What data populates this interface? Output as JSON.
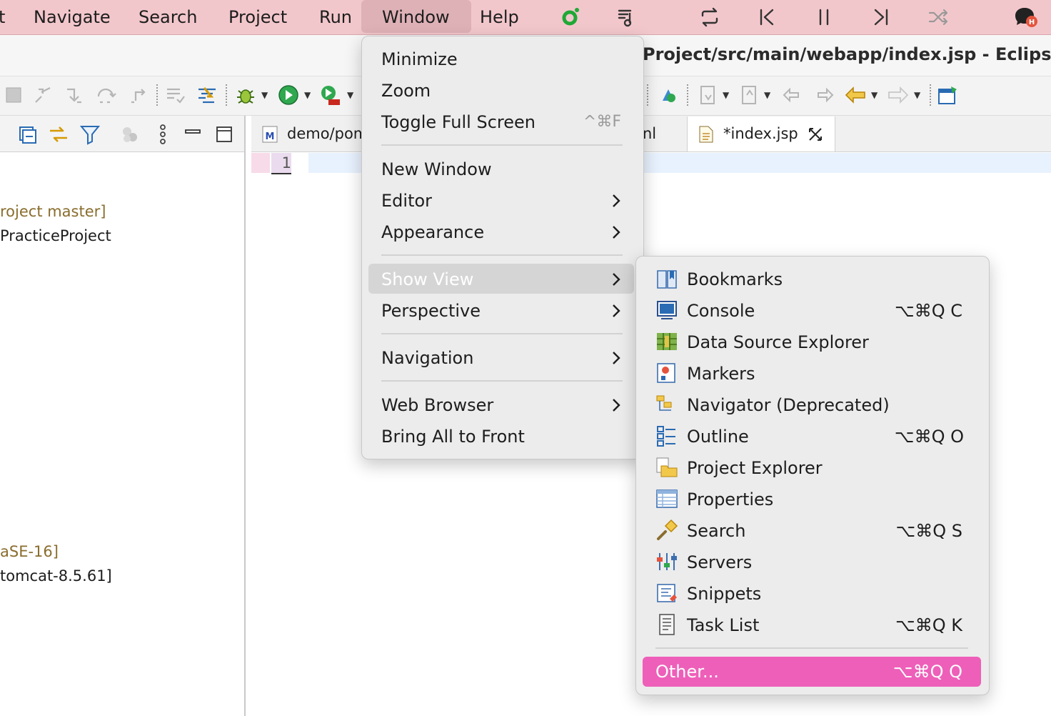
{
  "menubar": {
    "items": [
      "t",
      "Navigate",
      "Search",
      "Project",
      "Run",
      "Window",
      "Help"
    ]
  },
  "window_title": "Project/src/main/webapp/index.jsp - Eclipse I",
  "left_panel": {
    "tree": [
      {
        "text": "roject master]",
        "kind": "git"
      },
      {
        "text": "PracticeProject",
        "kind": "plain"
      },
      {
        "text": "aSE-16]",
        "kind": "git"
      },
      {
        "text": "tomcat-8.5.61]",
        "kind": "plain"
      }
    ]
  },
  "editor": {
    "tabs": [
      {
        "label": "demo/pom",
        "icon": "maven-pom-icon"
      },
      {
        "label": "nl",
        "icon": ""
      },
      {
        "label": "*index.jsp",
        "icon": "jsp-file-icon"
      }
    ],
    "line_number": "1"
  },
  "window_menu": {
    "items": [
      {
        "label": "Minimize"
      },
      {
        "label": "Zoom"
      },
      {
        "label": "Toggle Full Screen",
        "shortcut": "^⌘F"
      },
      {
        "label": "New Window"
      },
      {
        "label": "Editor",
        "submenu": true
      },
      {
        "label": "Appearance",
        "submenu": true
      },
      {
        "label": "Show View",
        "submenu": true,
        "state": "highlighted"
      },
      {
        "label": "Perspective",
        "submenu": true
      },
      {
        "label": "Navigation",
        "submenu": true
      },
      {
        "label": "Web Browser",
        "submenu": true
      },
      {
        "label": "Bring All to Front"
      }
    ]
  },
  "show_view_menu": {
    "items": [
      {
        "label": "Bookmarks",
        "shortcut": "",
        "icon": "bookmarks-icon"
      },
      {
        "label": "Console",
        "shortcut": "⌥⌘Q C",
        "icon": "console-icon"
      },
      {
        "label": "Data Source Explorer",
        "shortcut": "",
        "icon": "data-source-explorer-icon"
      },
      {
        "label": "Markers",
        "shortcut": "",
        "icon": "markers-icon"
      },
      {
        "label": "Navigator (Deprecated)",
        "shortcut": "",
        "icon": "navigator-icon"
      },
      {
        "label": "Outline",
        "shortcut": "⌥⌘Q O",
        "icon": "outline-icon"
      },
      {
        "label": "Project Explorer",
        "shortcut": "",
        "icon": "project-explorer-icon"
      },
      {
        "label": "Properties",
        "shortcut": "",
        "icon": "properties-icon"
      },
      {
        "label": "Search",
        "shortcut": "⌥⌘Q S",
        "icon": "search-view-icon"
      },
      {
        "label": "Servers",
        "shortcut": "",
        "icon": "servers-icon"
      },
      {
        "label": "Snippets",
        "shortcut": "",
        "icon": "snippets-icon"
      },
      {
        "label": "Task List",
        "shortcut": "⌥⌘Q K",
        "icon": "task-list-icon"
      },
      {
        "label": "Other...",
        "shortcut": "⌥⌘Q Q",
        "state": "selected"
      }
    ]
  },
  "colors": {
    "menubar_bg": "#f2c7cb",
    "selected_item": "#ee5fb9",
    "highlight_item": "#d5d5d5",
    "git_decoration": "#8a6d2e"
  }
}
